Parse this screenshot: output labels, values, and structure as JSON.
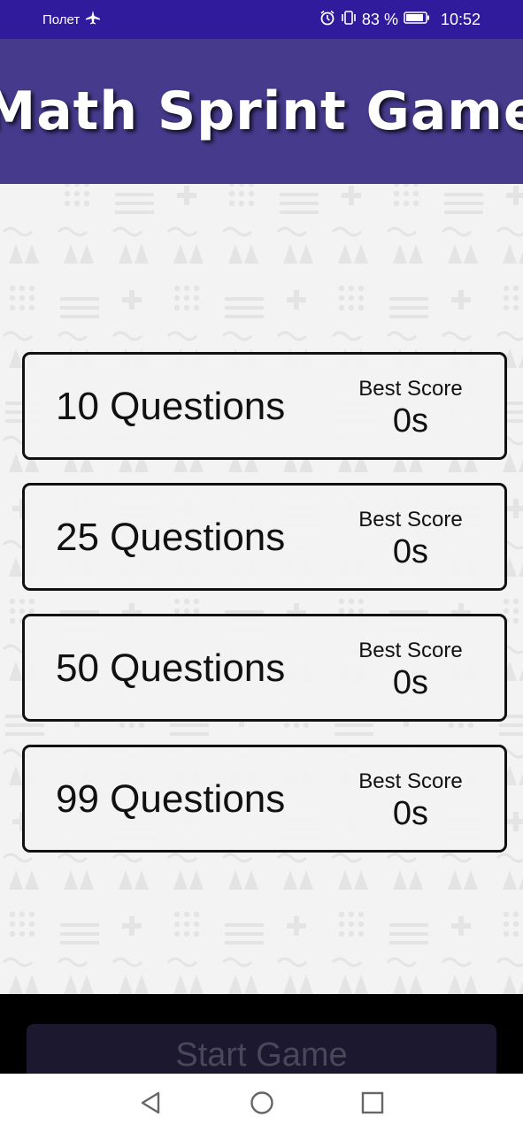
{
  "status_bar": {
    "carrier": "Полет",
    "battery": "83 %",
    "time": "10:52",
    "icons": [
      "airplane-icon",
      "alarm-icon",
      "vibrate-icon",
      "battery-icon"
    ]
  },
  "header": {
    "title": "Math Sprint Game"
  },
  "questions": [
    {
      "label": "10 Questions",
      "best_label": "Best Score",
      "best_value": "0s"
    },
    {
      "label": "25 Questions",
      "best_label": "Best Score",
      "best_value": "0s"
    },
    {
      "label": "50 Questions",
      "best_label": "Best Score",
      "best_value": "0s"
    },
    {
      "label": "99 Questions",
      "best_label": "Best Score",
      "best_value": "0s"
    }
  ],
  "footer": {
    "start_label": "Start Game"
  },
  "nav": {
    "icons": [
      "back-icon",
      "home-icon",
      "recents-icon"
    ]
  },
  "colors": {
    "status_bar": "#2f1b9c",
    "header": "#453a8c",
    "background": "#f3f3f3"
  }
}
